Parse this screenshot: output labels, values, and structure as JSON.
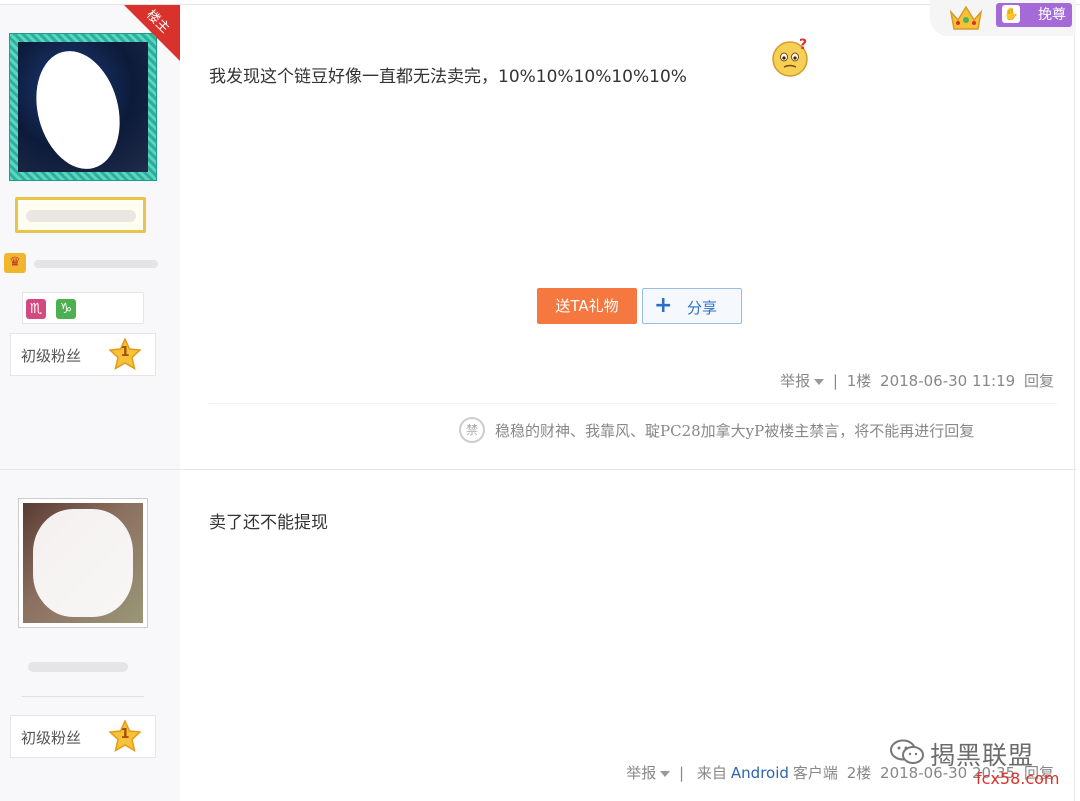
{
  "post1": {
    "louzhu_badge": "楼主",
    "fan_level": "初级粉丝",
    "level_number": "1",
    "zodiac": [
      "scorpio-icon",
      "capricorn-icon"
    ],
    "content_prefix": "我发现这个链豆好像一直都无法卖完，",
    "content_percent": "10%10%10%10%10%",
    "gift_button": "送TA礼物",
    "share_button": "分享",
    "report": "举报",
    "separator": "|",
    "floor": "1楼",
    "datetime": "2018-06-30 11:19",
    "reply": "回复",
    "ban_icon_text": "禁",
    "ban_notice": "稳稳的财神、我靠风、聢PC28加拿大yP被楼主禁言，将不能再进行回复"
  },
  "post2": {
    "fan_level": "初级粉丝",
    "level_number": "1",
    "content": "卖了还不能提现",
    "report": "举报",
    "separator": "|",
    "client_prefix": "来自",
    "client_name": "Android",
    "client_suffix": "客户端",
    "floor": "2楼",
    "datetime": "2018-06-30 20:35",
    "reply": "回复"
  },
  "top_badge": {
    "label": "挽尊",
    "icon": "thumbs-icon"
  },
  "watermark": {
    "title": "揭黑联盟",
    "url": "fcx58.com"
  },
  "colors": {
    "gift": "#f4783f",
    "share": "#2d6fc7",
    "louzhu": "#d9312b",
    "badge": "#a46bd8"
  }
}
